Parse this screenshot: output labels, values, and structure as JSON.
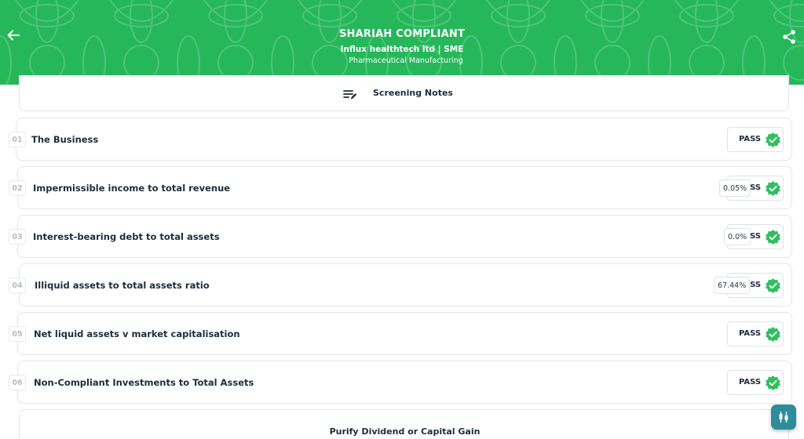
{
  "header": {
    "title": "SHARIAH COMPLIANT",
    "company": "Influx healthtech ltd | SME",
    "industry": "Pharmaceutical Manufacturing",
    "background_color": "#26b75b"
  },
  "notes": {
    "label": "Screening Notes",
    "icon": "edit-notes-icon"
  },
  "criteria": [
    {
      "num": "01",
      "label": "The Business",
      "status": "PASS",
      "value": ""
    },
    {
      "num": "02",
      "label": "Impermissible income to total revenue",
      "status": "PASS",
      "value": "0.05%"
    },
    {
      "num": "03",
      "label": "Interest-bearing debt to total assets",
      "status": "PASS",
      "value": "0.0%"
    },
    {
      "num": "04",
      "label": "Illiquid assets to total assets ratio",
      "status": "PASS",
      "value": "67.44%"
    },
    {
      "num": "05",
      "label": "Net liquid assets v market capitalisation",
      "status": "PASS",
      "value": ""
    },
    {
      "num": "06",
      "label": "Non-Compliant Investments to Total Assets",
      "status": "PASS",
      "value": ""
    }
  ],
  "bottom": {
    "label": "Purify Dividend or Capital Gain"
  },
  "colors": {
    "pass_badge": "#2fbf5f",
    "fab": "#2e8d9a",
    "text": "#1f2d3a"
  }
}
